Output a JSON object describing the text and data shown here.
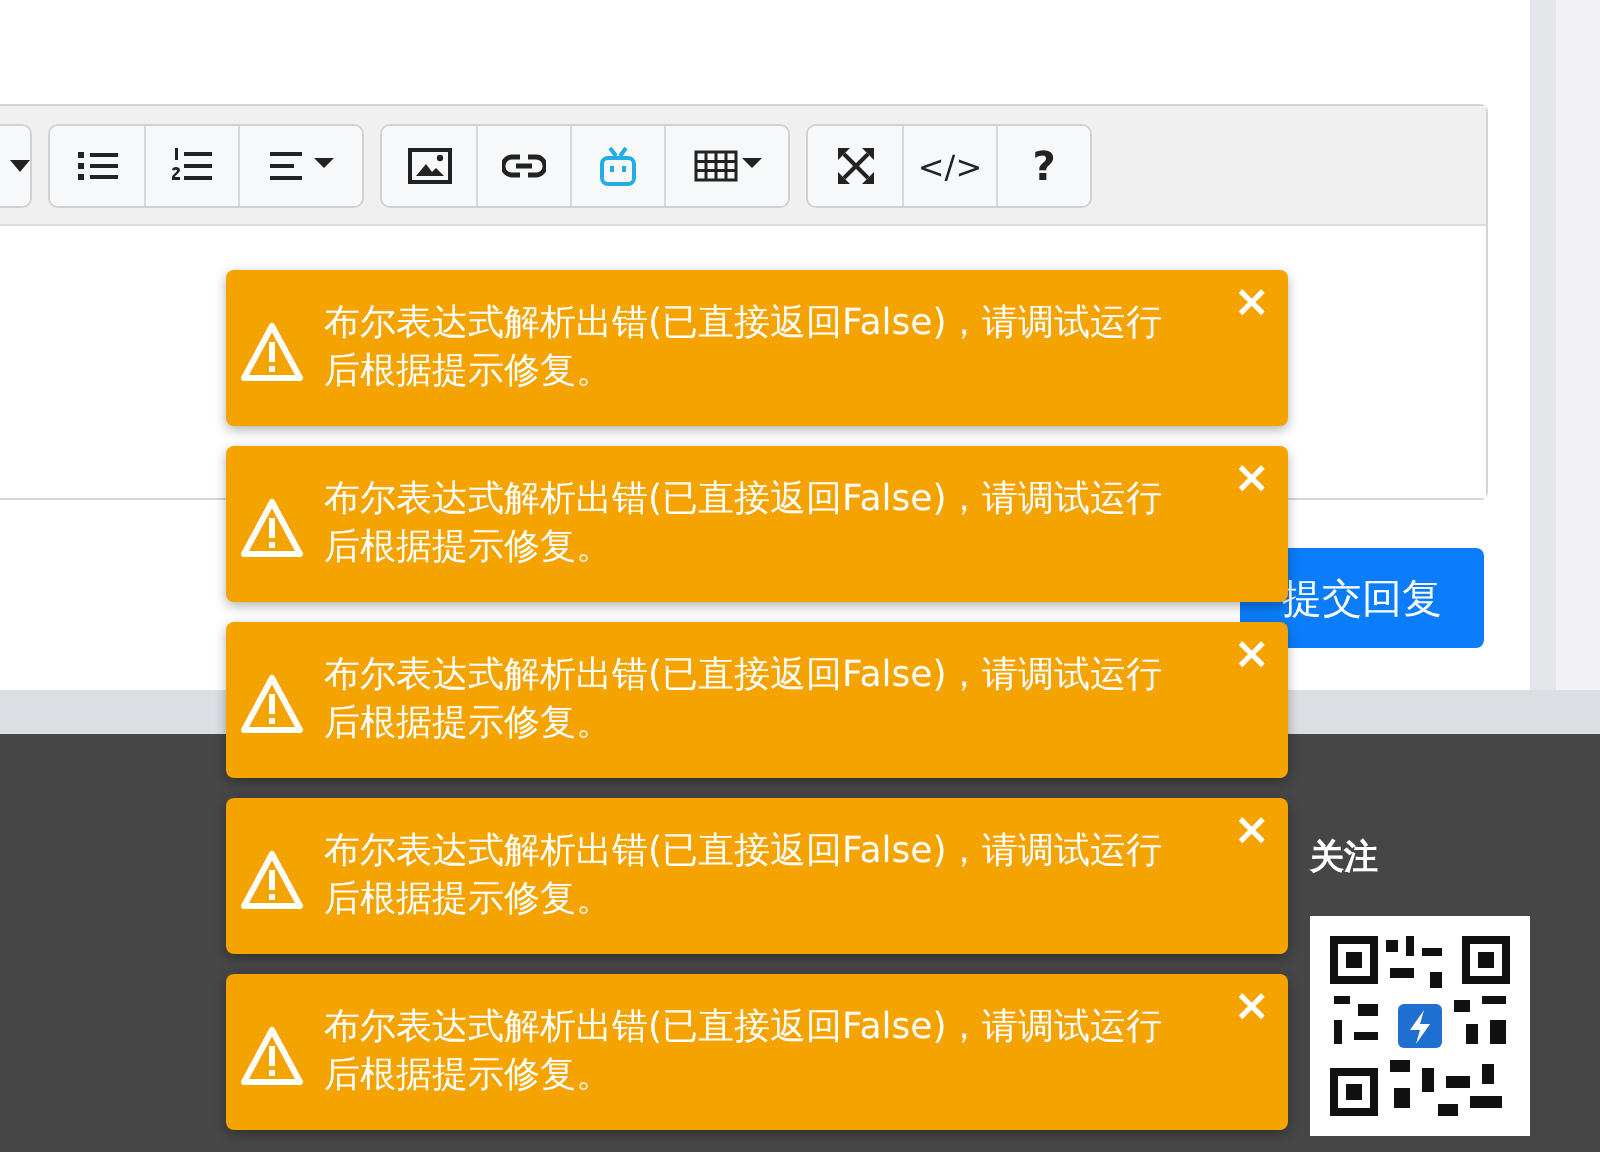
{
  "toolbar": {
    "groups": [
      {
        "buttons": [
          {
            "kind": "caret"
          }
        ]
      },
      {
        "buttons": [
          {
            "kind": "bullet-list"
          },
          {
            "kind": "numbered-list"
          },
          {
            "kind": "align"
          }
        ]
      },
      {
        "buttons": [
          {
            "kind": "image"
          },
          {
            "kind": "link"
          },
          {
            "kind": "tv"
          },
          {
            "kind": "table"
          }
        ]
      },
      {
        "buttons": [
          {
            "kind": "fullscreen"
          },
          {
            "kind": "text",
            "label": "</>"
          },
          {
            "kind": "text",
            "label": "?"
          }
        ]
      }
    ]
  },
  "submit_button": "提交回复",
  "footer": {
    "follow_heading": "关注"
  },
  "toasts": [
    {
      "message": "布尔表达式解析出错(已直接返回False)，请调试运行后根据提示修复。",
      "close": "×"
    },
    {
      "message": "布尔表达式解析出错(已直接返回False)，请调试运行后根据提示修复。",
      "close": "×"
    },
    {
      "message": "布尔表达式解析出错(已直接返回False)，请调试运行后根据提示修复。",
      "close": "×"
    },
    {
      "message": "布尔表达式解析出错(已直接返回False)，请调试运行后根据提示修复。",
      "close": "×"
    },
    {
      "message": "布尔表达式解析出错(已直接返回False)，请调试运行后根据提示修复。",
      "close": "×"
    }
  ]
}
